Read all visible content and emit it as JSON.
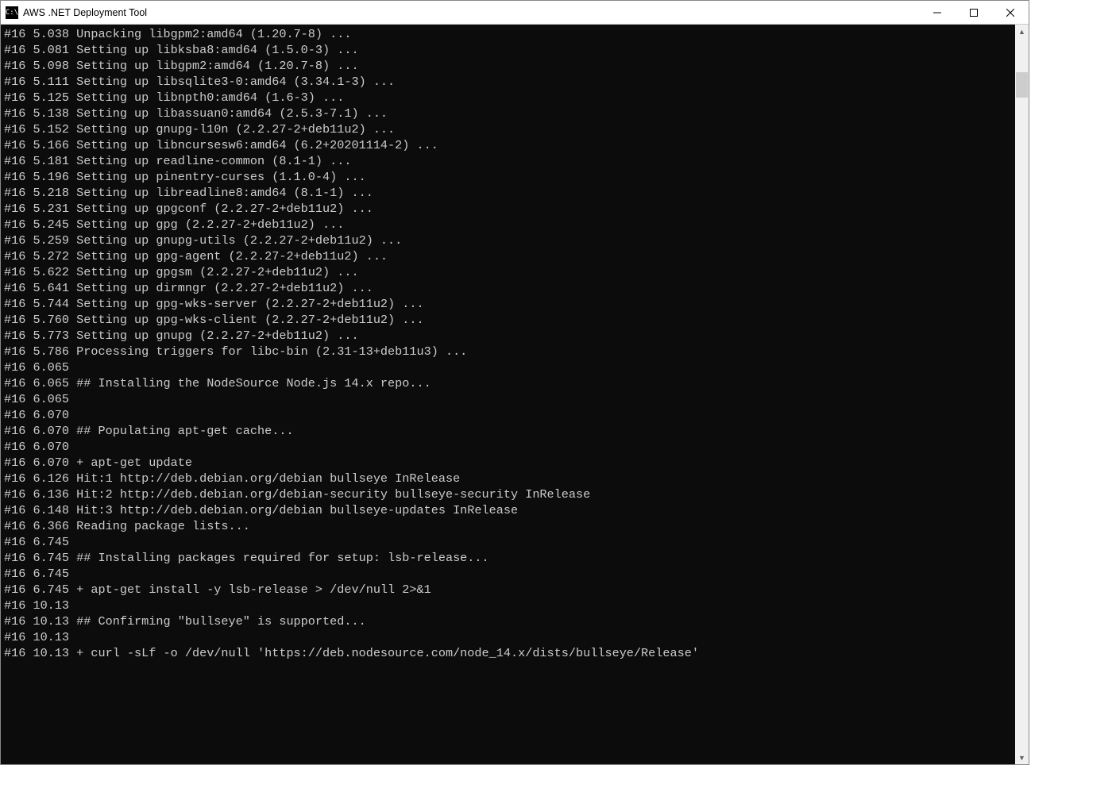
{
  "window": {
    "title": "AWS .NET Deployment Tool",
    "icon_label": "C:\\"
  },
  "log_lines": [
    "#16 5.038 Unpacking libgpm2:amd64 (1.20.7-8) ...",
    "#16 5.081 Setting up libksba8:amd64 (1.5.0-3) ...",
    "#16 5.098 Setting up libgpm2:amd64 (1.20.7-8) ...",
    "#16 5.111 Setting up libsqlite3-0:amd64 (3.34.1-3) ...",
    "#16 5.125 Setting up libnpth0:amd64 (1.6-3) ...",
    "#16 5.138 Setting up libassuan0:amd64 (2.5.3-7.1) ...",
    "#16 5.152 Setting up gnupg-l10n (2.2.27-2+deb11u2) ...",
    "#16 5.166 Setting up libncursesw6:amd64 (6.2+20201114-2) ...",
    "#16 5.181 Setting up readline-common (8.1-1) ...",
    "#16 5.196 Setting up pinentry-curses (1.1.0-4) ...",
    "#16 5.218 Setting up libreadline8:amd64 (8.1-1) ...",
    "#16 5.231 Setting up gpgconf (2.2.27-2+deb11u2) ...",
    "#16 5.245 Setting up gpg (2.2.27-2+deb11u2) ...",
    "#16 5.259 Setting up gnupg-utils (2.2.27-2+deb11u2) ...",
    "#16 5.272 Setting up gpg-agent (2.2.27-2+deb11u2) ...",
    "#16 5.622 Setting up gpgsm (2.2.27-2+deb11u2) ...",
    "#16 5.641 Setting up dirmngr (2.2.27-2+deb11u2) ...",
    "#16 5.744 Setting up gpg-wks-server (2.2.27-2+deb11u2) ...",
    "#16 5.760 Setting up gpg-wks-client (2.2.27-2+deb11u2) ...",
    "#16 5.773 Setting up gnupg (2.2.27-2+deb11u2) ...",
    "#16 5.786 Processing triggers for libc-bin (2.31-13+deb11u3) ...",
    "#16 6.065",
    "#16 6.065 ## Installing the NodeSource Node.js 14.x repo...",
    "#16 6.065",
    "#16 6.070",
    "#16 6.070 ## Populating apt-get cache...",
    "#16 6.070",
    "#16 6.070 + apt-get update",
    "#16 6.126 Hit:1 http://deb.debian.org/debian bullseye InRelease",
    "#16 6.136 Hit:2 http://deb.debian.org/debian-security bullseye-security InRelease",
    "#16 6.148 Hit:3 http://deb.debian.org/debian bullseye-updates InRelease",
    "#16 6.366 Reading package lists...",
    "#16 6.745",
    "#16 6.745 ## Installing packages required for setup: lsb-release...",
    "#16 6.745",
    "#16 6.745 + apt-get install -y lsb-release > /dev/null 2>&1",
    "#16 10.13",
    "#16 10.13 ## Confirming \"bullseye\" is supported...",
    "#16 10.13",
    "#16 10.13 + curl -sLf -o /dev/null 'https://deb.nodesource.com/node_14.x/dists/bullseye/Release'"
  ]
}
